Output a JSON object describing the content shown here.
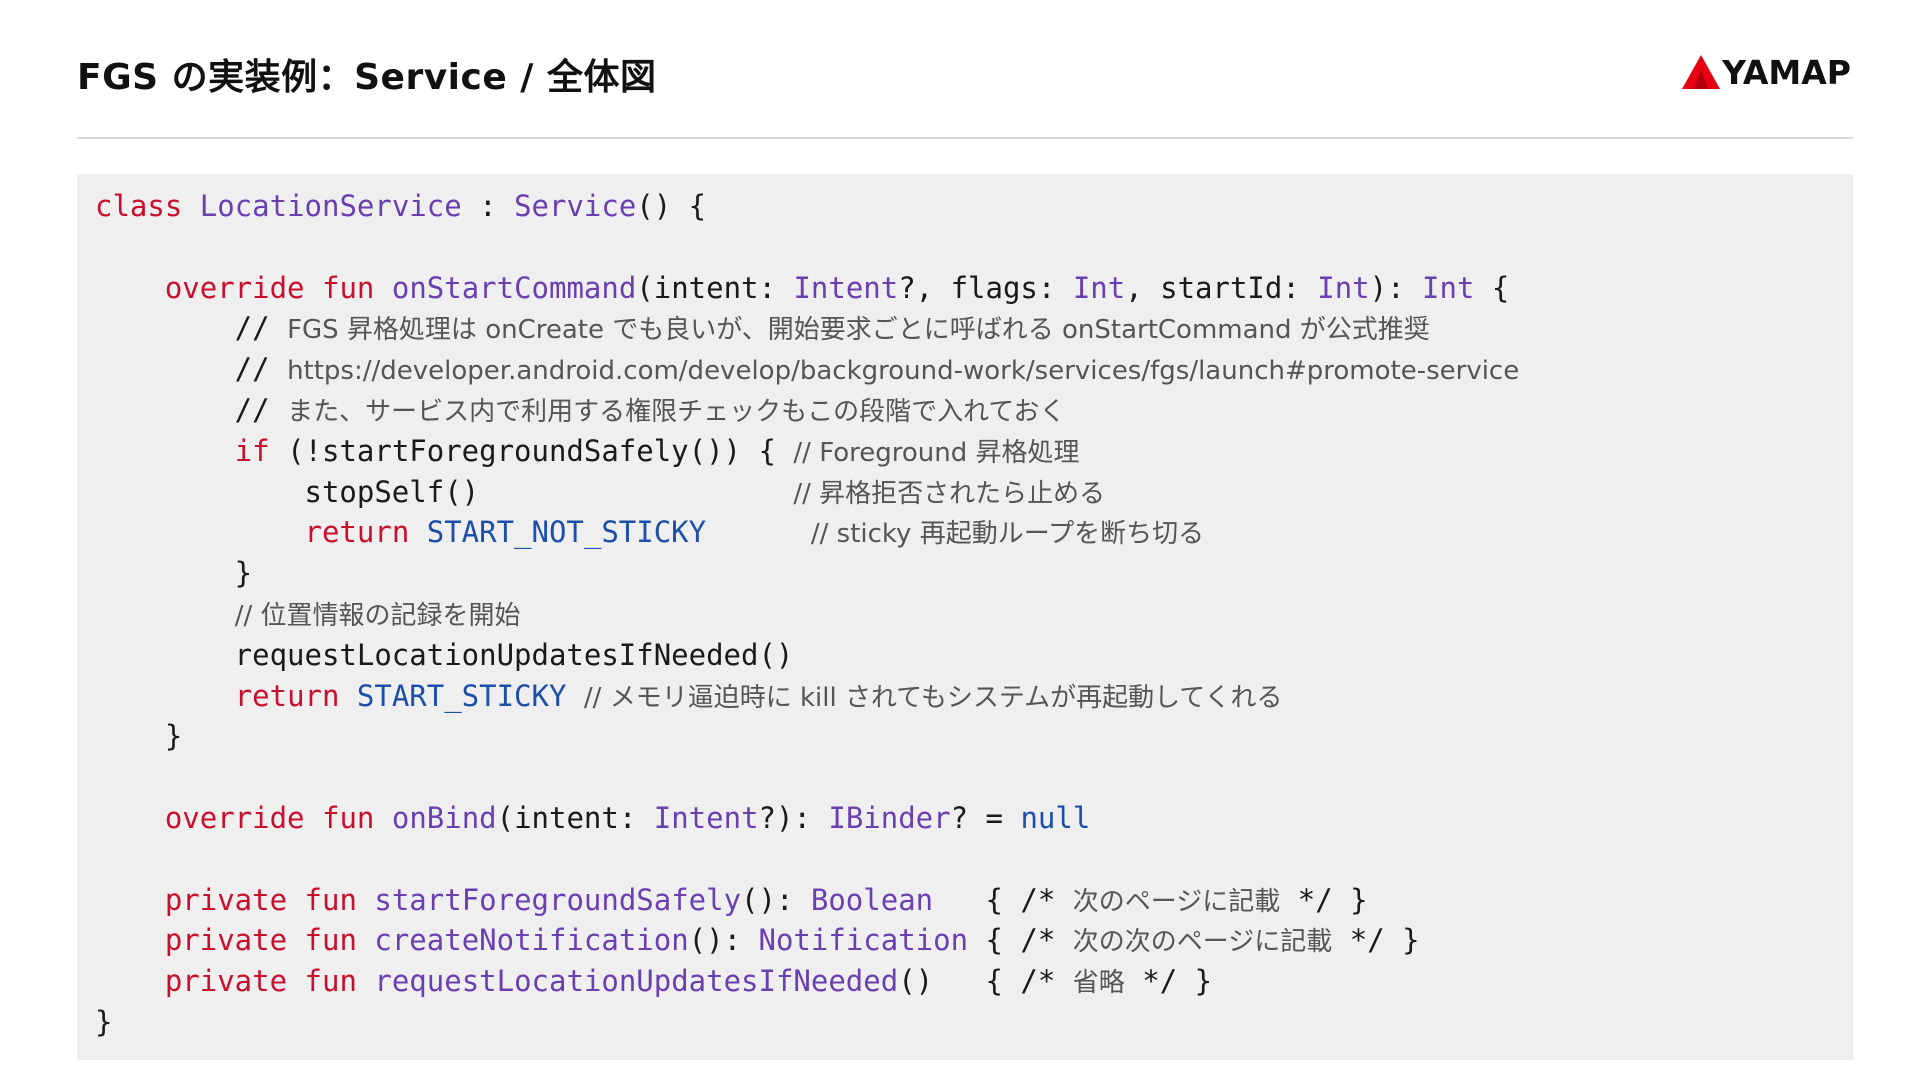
{
  "header": {
    "title": "FGS の実装例：Service / 全体図",
    "logo_text": "YAMAP"
  },
  "colors": {
    "keyword": "#c8102e",
    "type": "#6a3fb0",
    "constant": "#1c4fa8",
    "plain": "#1a1a1a",
    "comment": "#555555",
    "panel_background": "#efefef",
    "logo_mark": "#e60012"
  },
  "code": {
    "language": "kotlin",
    "lines": [
      [
        {
          "t": "class",
          "k": "kw"
        },
        {
          "t": " ",
          "k": "pl"
        },
        {
          "t": "LocationService",
          "k": "ty"
        },
        {
          "t": " : ",
          "k": "pl"
        },
        {
          "t": "Service",
          "k": "ty"
        },
        {
          "t": "() {",
          "k": "pl"
        }
      ],
      [],
      [
        {
          "t": "    ",
          "k": "pl"
        },
        {
          "t": "override",
          "k": "kw"
        },
        {
          "t": " ",
          "k": "pl"
        },
        {
          "t": "fun",
          "k": "kw"
        },
        {
          "t": " ",
          "k": "pl"
        },
        {
          "t": "onStartCommand",
          "k": "ty"
        },
        {
          "t": "(intent: ",
          "k": "pl"
        },
        {
          "t": "Intent",
          "k": "ty"
        },
        {
          "t": "?, flags: ",
          "k": "pl"
        },
        {
          "t": "Int",
          "k": "ty"
        },
        {
          "t": ", startId: ",
          "k": "pl"
        },
        {
          "t": "Int",
          "k": "ty"
        },
        {
          "t": "): ",
          "k": "pl"
        },
        {
          "t": "Int",
          "k": "ty"
        },
        {
          "t": " {",
          "k": "pl"
        }
      ],
      [
        {
          "t": "        // ",
          "k": "pl"
        },
        {
          "t": "FGS 昇格処理は onCreate でも良いが、開始要求ごとに呼ばれる onStartCommand が公式推奨",
          "k": "cm"
        }
      ],
      [
        {
          "t": "        // ",
          "k": "pl"
        },
        {
          "t": "https://developer.android.com/develop/background-work/services/fgs/launch#promote-service",
          "k": "cm"
        }
      ],
      [
        {
          "t": "        // ",
          "k": "pl"
        },
        {
          "t": "また、サービス内で利用する権限チェックもこの段階で入れておく",
          "k": "cm"
        }
      ],
      [
        {
          "t": "        ",
          "k": "pl"
        },
        {
          "t": "if",
          "k": "kw"
        },
        {
          "t": " (!startForegroundSafely()) { ",
          "k": "pl"
        },
        {
          "t": "// Foreground 昇格処理",
          "k": "cm"
        }
      ],
      [
        {
          "t": "            stopSelf()                  ",
          "k": "pl"
        },
        {
          "t": "// 昇格拒否されたら止める",
          "k": "cm"
        }
      ],
      [
        {
          "t": "            ",
          "k": "pl"
        },
        {
          "t": "return",
          "k": "kw"
        },
        {
          "t": " ",
          "k": "pl"
        },
        {
          "t": "START_NOT_STICKY",
          "k": "cn"
        },
        {
          "t": "      ",
          "k": "pl"
        },
        {
          "t": "// sticky 再起動ループを断ち切る",
          "k": "cm"
        }
      ],
      [
        {
          "t": "        }",
          "k": "pl"
        }
      ],
      [
        {
          "t": "        ",
          "k": "pl"
        },
        {
          "t": "// 位置情報の記録を開始",
          "k": "cm"
        }
      ],
      [
        {
          "t": "        requestLocationUpdatesIfNeeded()",
          "k": "pl"
        }
      ],
      [
        {
          "t": "        ",
          "k": "pl"
        },
        {
          "t": "return",
          "k": "kw"
        },
        {
          "t": " ",
          "k": "pl"
        },
        {
          "t": "START_STICKY",
          "k": "cn"
        },
        {
          "t": " ",
          "k": "pl"
        },
        {
          "t": "// メモリ逼迫時に kill されてもシステムが再起動してくれる",
          "k": "cm"
        }
      ],
      [
        {
          "t": "    }",
          "k": "pl"
        }
      ],
      [],
      [
        {
          "t": "    ",
          "k": "pl"
        },
        {
          "t": "override",
          "k": "kw"
        },
        {
          "t": " ",
          "k": "pl"
        },
        {
          "t": "fun",
          "k": "kw"
        },
        {
          "t": " ",
          "k": "pl"
        },
        {
          "t": "onBind",
          "k": "ty"
        },
        {
          "t": "(intent: ",
          "k": "pl"
        },
        {
          "t": "Intent",
          "k": "ty"
        },
        {
          "t": "?): ",
          "k": "pl"
        },
        {
          "t": "IBinder",
          "k": "ty"
        },
        {
          "t": "? = ",
          "k": "pl"
        },
        {
          "t": "null",
          "k": "cn"
        }
      ],
      [],
      [
        {
          "t": "    ",
          "k": "pl"
        },
        {
          "t": "private",
          "k": "kw"
        },
        {
          "t": " ",
          "k": "pl"
        },
        {
          "t": "fun",
          "k": "kw"
        },
        {
          "t": " ",
          "k": "pl"
        },
        {
          "t": "startForegroundSafely",
          "k": "ty"
        },
        {
          "t": "(): ",
          "k": "pl"
        },
        {
          "t": "Boolean",
          "k": "ty"
        },
        {
          "t": "   { /* ",
          "k": "pl"
        },
        {
          "t": "次のページに記載",
          "k": "cm"
        },
        {
          "t": " */ }",
          "k": "pl"
        }
      ],
      [
        {
          "t": "    ",
          "k": "pl"
        },
        {
          "t": "private",
          "k": "kw"
        },
        {
          "t": " ",
          "k": "pl"
        },
        {
          "t": "fun",
          "k": "kw"
        },
        {
          "t": " ",
          "k": "pl"
        },
        {
          "t": "createNotification",
          "k": "ty"
        },
        {
          "t": "(): ",
          "k": "pl"
        },
        {
          "t": "Notification",
          "k": "ty"
        },
        {
          "t": " { /* ",
          "k": "pl"
        },
        {
          "t": "次の次のページに記載",
          "k": "cm"
        },
        {
          "t": " */ }",
          "k": "pl"
        }
      ],
      [
        {
          "t": "    ",
          "k": "pl"
        },
        {
          "t": "private",
          "k": "kw"
        },
        {
          "t": " ",
          "k": "pl"
        },
        {
          "t": "fun",
          "k": "kw"
        },
        {
          "t": " ",
          "k": "pl"
        },
        {
          "t": "requestLocationUpdatesIfNeeded",
          "k": "ty"
        },
        {
          "t": "()   { /* ",
          "k": "pl"
        },
        {
          "t": "省略",
          "k": "cm"
        },
        {
          "t": " */ }",
          "k": "pl"
        }
      ],
      [
        {
          "t": "}",
          "k": "pl"
        }
      ]
    ]
  }
}
